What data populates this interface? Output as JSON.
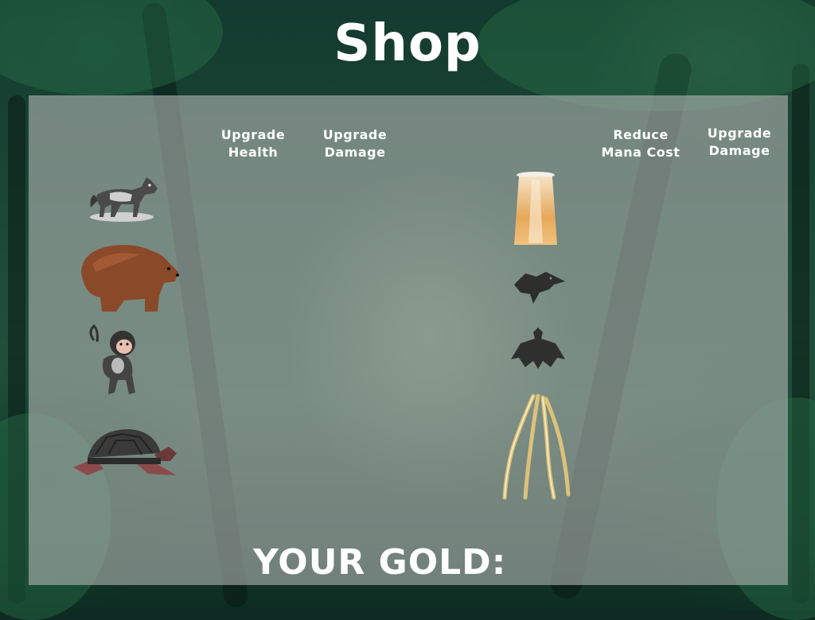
{
  "title": "Shop",
  "columns": {
    "upgrade_health": [
      "Upgrade",
      "Health"
    ],
    "upgrade_damage_left": [
      "Upgrade",
      "Damage"
    ],
    "reduce_mana": [
      "Reduce",
      "Mana Cost"
    ],
    "upgrade_damage_right": [
      "Upgrade",
      "Damage"
    ]
  },
  "gold_label": "YOUR GOLD:"
}
